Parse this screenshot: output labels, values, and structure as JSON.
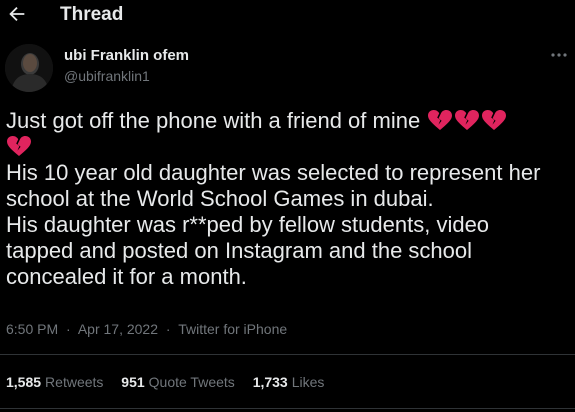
{
  "header": {
    "back_icon": "arrow-left-icon",
    "title": "Thread"
  },
  "author": {
    "name": "ubi Franklin ofem",
    "handle": "@ubifranklin1"
  },
  "more_icon": "ellipsis-icon",
  "tweet": {
    "line1": "Just got off the phone with a friend of mine",
    "emoji": "broken-heart-icon",
    "emoji_color": "#e0245e",
    "line2": "His 10 year old daughter was selected to represent her",
    "line3": "school  at the World School Games in dubai.",
    "line4": "His daughter was r**ped by fellow students, video",
    "line5": "tapped and posted on Instagram and the school",
    "line6": "concealed it for a month."
  },
  "meta": {
    "time": "6:50 PM",
    "separator": "·",
    "date": "Apr 17, 2022",
    "source": "Twitter for iPhone"
  },
  "stats": {
    "retweets_count": "1,585",
    "retweets_label": "Retweets",
    "quotes_count": "951",
    "quotes_label": "Quote Tweets",
    "likes_count": "1,733",
    "likes_label": "Likes"
  },
  "colors": {
    "background": "#000000",
    "text": "#e7e9ea",
    "muted": "#71767b",
    "divider": "#2f3336"
  }
}
